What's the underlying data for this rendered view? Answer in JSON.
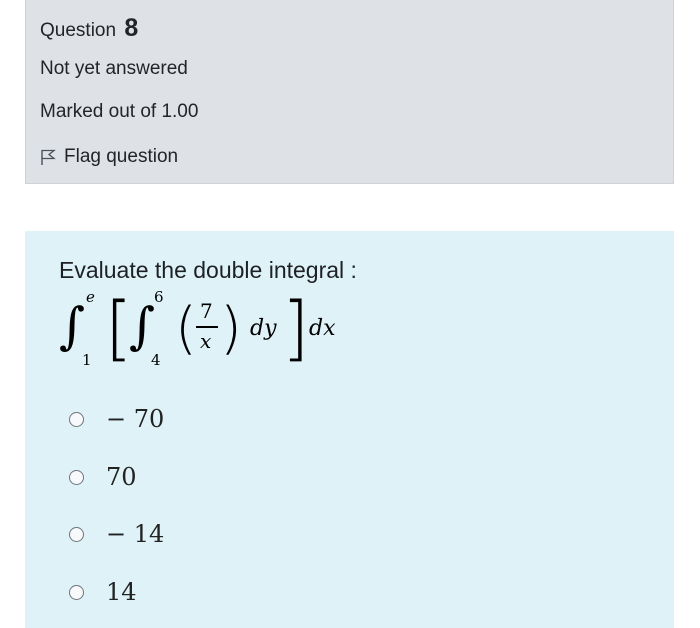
{
  "info": {
    "question_word": "Question",
    "question_number": "8",
    "state": "Not yet answered",
    "grade": "Marked out of 1.00",
    "flag_label": "Flag question"
  },
  "question": {
    "text": "Evaluate the double integral :",
    "math": {
      "outer_upper": "e",
      "outer_lower": "1",
      "inner_upper": "6",
      "inner_lower": "4",
      "numerator": "7",
      "denominator": "x",
      "inner_diff": "dy",
      "outer_diff": "dx"
    }
  },
  "options": [
    {
      "label": "− 70"
    },
    {
      "label": "70"
    },
    {
      "label": "− 14"
    },
    {
      "label": "14"
    }
  ],
  "colors": {
    "info_bg": "#dee2e6",
    "formulation_bg": "#def2f8"
  }
}
